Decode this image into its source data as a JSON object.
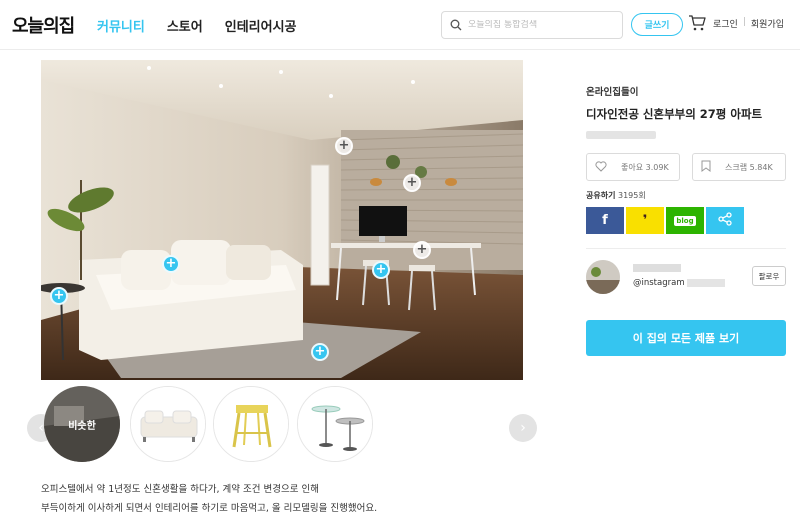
{
  "header": {
    "logo": "오늘의집",
    "nav": [
      {
        "label": "커뮤니티",
        "active": true
      },
      {
        "label": "스토어",
        "active": false
      },
      {
        "label": "인테리어시공",
        "active": false
      }
    ],
    "search_placeholder": "오늘의집 통합검색",
    "write_label": "글쓰기",
    "login_label": "로그인",
    "separator": "|",
    "signup_label": "회원가입"
  },
  "photo": {
    "tags_count": 8
  },
  "thumbnails": {
    "selected_label": "비슷한",
    "items": [
      "rug",
      "sofa",
      "stool",
      "side-tables"
    ]
  },
  "description": {
    "line1": "오피스텔에서 약 1년정도 신혼생활을 하다가, 계약 조건 변경으로 인해",
    "line2": "부득이하게 이사하게 되면서 인테리어를 하기로 마음먹고, 올 리모델링을 진행했어요."
  },
  "sidebar": {
    "category": "온라인집들이",
    "title": "디자인전공 신혼부부의 27평 아파트",
    "like_label": "좋아요",
    "like_count": "3.09K",
    "scrap_label": "스크랩",
    "scrap_count": "5.84K",
    "share_label": "공유하기",
    "share_count": "3195회",
    "share_buttons": [
      "f",
      "❜",
      "blog",
      "share"
    ],
    "author_handle": "@instagram",
    "follow_label": "팔로우",
    "all_products_label": "이 집의 모든 제품 보기"
  },
  "colors": {
    "accent": "#35c5f0",
    "facebook": "#3b5998",
    "kakao": "#f9e000",
    "blog": "#2db400",
    "share": "#35c5f0"
  }
}
